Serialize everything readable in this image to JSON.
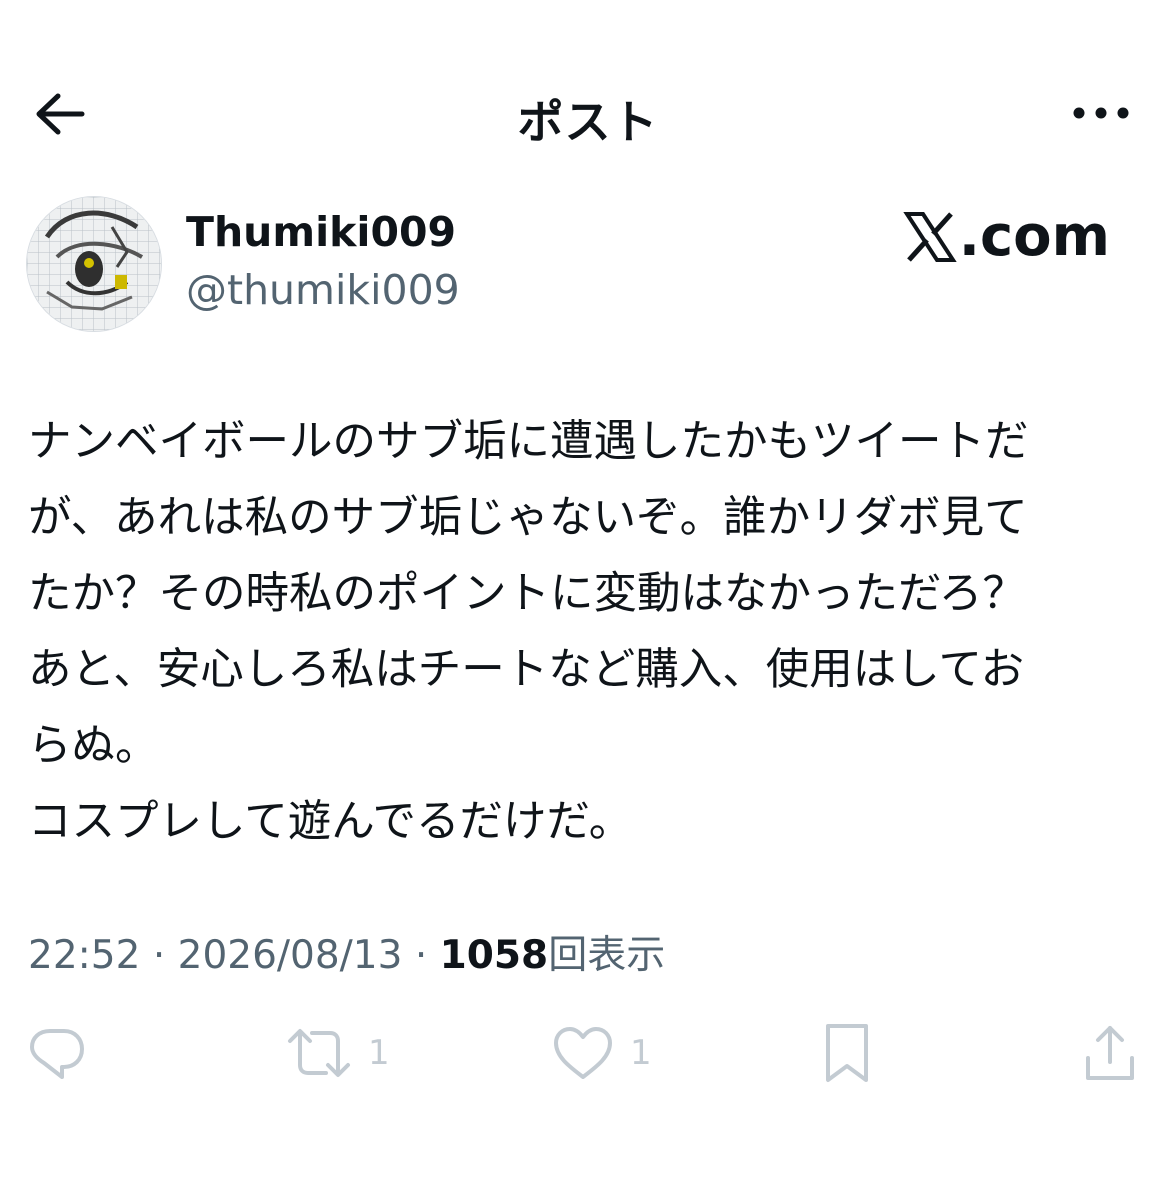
{
  "header": {
    "title": "ポスト",
    "back_icon": "back-arrow-icon",
    "more_icon": "more-horizontal-icon"
  },
  "author": {
    "display_name": "Thumiki009",
    "handle": "@thumiki009",
    "avatar": "avatar-image"
  },
  "watermark": {
    "text": ".com",
    "logo_icon": "x-logo-icon"
  },
  "post": {
    "lines": [
      "ナンベイボールのサブ垢に遭遇したかもツイートだ",
      "が、あれは私のサブ垢じゃないぞ。誰かリダボ見て",
      "たか？その時私のポイントに変動はなかっただろ？",
      "あと、安心しろ私はチートなど購入、使用はしてお",
      "らぬ。",
      "コスプレして遊んでるだけだ。"
    ]
  },
  "meta": {
    "time": "22:52",
    "separator": "·",
    "date": "2026/08/13",
    "views_count": "1058",
    "views_label": "回表示"
  },
  "actions": {
    "reply": {
      "icon": "reply-icon",
      "count": ""
    },
    "repost": {
      "icon": "repost-icon",
      "count": "1"
    },
    "like": {
      "icon": "heart-icon",
      "count": "1"
    },
    "bookmark": {
      "icon": "bookmark-icon",
      "count": ""
    },
    "share": {
      "icon": "share-icon",
      "count": ""
    }
  },
  "colors": {
    "text_primary": "#0f1419",
    "text_secondary": "#536471",
    "action_icons": "#c3cbd2",
    "background": "#ffffff"
  }
}
